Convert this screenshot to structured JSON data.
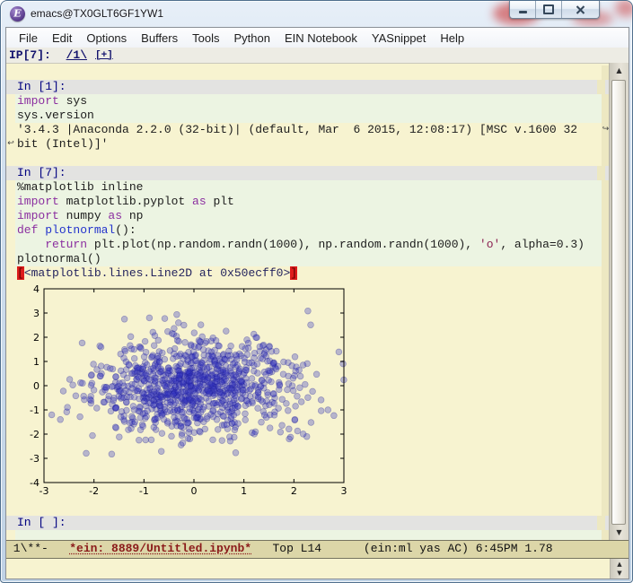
{
  "window": {
    "title": "emacs@TX0GLT6GF1YW1",
    "icon": "emacs-logo",
    "controls": {
      "minimize": "minimize",
      "maximize": "maximize",
      "close": "close"
    }
  },
  "menu_bar": {
    "items": [
      "File",
      "Edit",
      "Options",
      "Buffers",
      "Tools",
      "Python",
      "EIN Notebook",
      "YASnippet",
      "Help"
    ]
  },
  "header_line": {
    "prefix": "IP[7]: ",
    "slide_link": "/1\\",
    "new_tab_link": "[+]"
  },
  "buffer": {
    "lines": [
      {
        "type": "blank"
      },
      {
        "type": "prompt",
        "text": "In [1]:"
      },
      {
        "type": "code",
        "segs": [
          [
            "import",
            "kw"
          ],
          [
            " sys",
            "pl"
          ]
        ]
      },
      {
        "type": "code",
        "segs": [
          [
            "sys.version",
            "pl"
          ]
        ]
      },
      {
        "type": "output",
        "fringe_right": true,
        "segs": [
          [
            "'3.4.3 |Anaconda 2.2.0 (32-bit)| (default, Mar  6 2015, 12:08:17) [MSC v.1600 32",
            "pl"
          ]
        ]
      },
      {
        "type": "output",
        "fringe_left": true,
        "segs": [
          [
            "bit (Intel)]'",
            "pl"
          ]
        ]
      },
      {
        "type": "blank"
      },
      {
        "type": "prompt",
        "text": "In [7]:"
      },
      {
        "type": "code",
        "segs": [
          [
            "%matplotlib inline",
            "pl"
          ]
        ]
      },
      {
        "type": "code",
        "segs": [
          [
            "import",
            "kw"
          ],
          [
            " matplotlib.pyplot ",
            "pl"
          ],
          [
            "as",
            "kw"
          ],
          [
            " plt",
            "pl"
          ]
        ]
      },
      {
        "type": "code",
        "segs": [
          [
            "import",
            "kw"
          ],
          [
            " numpy ",
            "pl"
          ],
          [
            "as",
            "kw"
          ],
          [
            " np",
            "pl"
          ]
        ]
      },
      {
        "type": "code",
        "segs": [
          [
            "def",
            "kw"
          ],
          [
            " ",
            "pl"
          ],
          [
            "plotnormal",
            "fn"
          ],
          [
            "():",
            "pl"
          ]
        ]
      },
      {
        "type": "code",
        "segs": [
          [
            "    ",
            "pl"
          ],
          [
            "return",
            "kw"
          ],
          [
            " plt.plot(np.random.randn(1000), np.random.randn(1000), ",
            "pl"
          ],
          [
            "'o'",
            "str"
          ],
          [
            ", alpha=0.3)",
            "pl"
          ]
        ]
      },
      {
        "type": "code",
        "segs": [
          [
            "plotnormal()",
            "pl"
          ]
        ]
      },
      {
        "type": "output",
        "segs": [
          [
            "[",
            "paren"
          ],
          [
            "<matplotlib.lines.Line2D at 0x50ecff0>",
            "out"
          ],
          [
            "]",
            "paren"
          ]
        ]
      },
      {
        "type": "figure"
      },
      {
        "type": "blank"
      },
      {
        "type": "prompt",
        "text": "In [ ]:"
      },
      {
        "type": "code",
        "segs": [
          [
            "",
            "pl"
          ]
        ]
      }
    ],
    "wrap_left_glyph": "↩",
    "wrap_right_glyph": "↪"
  },
  "chart_data": {
    "type": "scatter",
    "title": "",
    "xlabel": "",
    "ylabel": "",
    "xlim": [
      -3,
      3
    ],
    "ylim": [
      -4,
      4
    ],
    "xticks": [
      -3,
      -2,
      -1,
      0,
      1,
      2,
      3
    ],
    "yticks": [
      -4,
      -3,
      -2,
      -1,
      0,
      1,
      2,
      3,
      4
    ],
    "n_points": 1000,
    "x_distribution": "standard normal (np.random.randn(1000))",
    "y_distribution": "standard normal (np.random.randn(1000))",
    "marker": "o",
    "alpha": 0.3,
    "marker_color": "#3232c0",
    "marker_edge_color": "#1f1f96",
    "marker_radius_px": 3.4,
    "grid": false,
    "legend_position": "none",
    "tick_direction": "in",
    "seed": 11
  },
  "mode_line": {
    "flags": " 1\\**-   ",
    "buffer_name": "*ein: 8889/Untitled.ipynb*",
    "position": "   Top L14      ",
    "modes": "(ein:ml yas AC)",
    "clock": " 6:45PM ",
    "load": "1.78"
  },
  "scrollbar": {
    "up_glyph": "▲",
    "down_glyph": "▼"
  },
  "colors": {
    "buffer_bg": "#f7f3d0",
    "code_bg": "#ecf4e2",
    "header_bg": "#edece4",
    "prompt_bg": "#e3e3e1",
    "prompt_fg": "#000080",
    "keyword": "#8b2fa0",
    "function_name": "#2333cc",
    "string": "#8b2252",
    "plain": "#1c1c1c",
    "output": "#24245e",
    "bracket_bg": "#dd1c1c",
    "bracket_fg": "#5a0000",
    "link": "#14146e",
    "modeline_bg": "#dcd6a8",
    "modeline_fg": "#101010",
    "buffer_id": "#8b1a1a",
    "fringe_right_bg": "#ede8c2",
    "axis_color": "#000000"
  }
}
